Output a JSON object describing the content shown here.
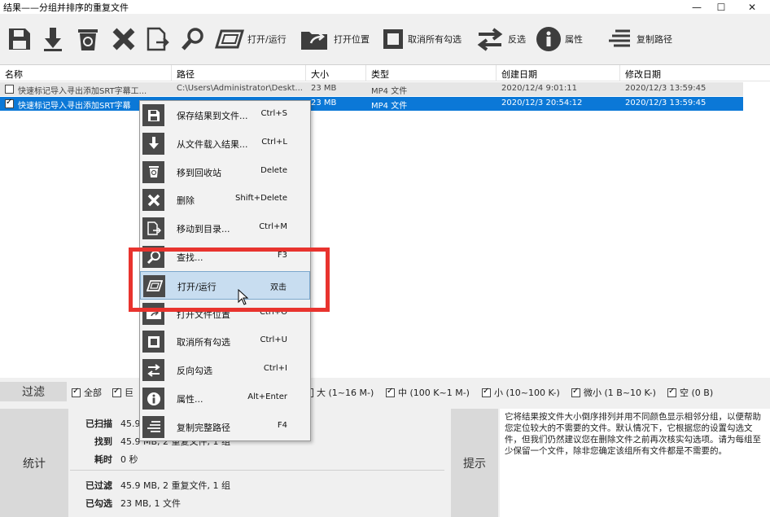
{
  "window": {
    "title": "结果——分组并排序的重复文件"
  },
  "toolbar": {
    "buttons": [
      {
        "icon": "save-icon",
        "label": ""
      },
      {
        "icon": "download-icon",
        "label": ""
      },
      {
        "icon": "recycle-bin-icon",
        "label": ""
      },
      {
        "icon": "delete-x-icon",
        "label": ""
      },
      {
        "icon": "move-file-icon",
        "label": ""
      },
      {
        "icon": "search-icon",
        "label": ""
      },
      {
        "icon": "open-run-icon",
        "label": "打开/运行"
      },
      {
        "icon": "open-location-icon",
        "label": "打开位置"
      },
      {
        "icon": "uncheck-all-icon",
        "label": "取消所有勾选"
      },
      {
        "icon": "invert-selection-icon",
        "label": "反选"
      },
      {
        "icon": "info-icon",
        "label": "属性"
      },
      {
        "icon": "copy-path-icon",
        "label": "复制路径"
      }
    ]
  },
  "list": {
    "columns": [
      "名称",
      "路径",
      "大小",
      "类型",
      "创建日期",
      "修改日期"
    ],
    "rows": [
      {
        "checked": false,
        "name": "快速标记导入寻出添加SRT字幕工...",
        "path": "C:\\Users\\Administrator\\Deskt...",
        "size": "23 MB",
        "type": "MP4 文件",
        "created": "2020/12/4 9:01:11",
        "modified": "2020/12/3 13:59:45"
      },
      {
        "checked": true,
        "name": "快速标记导入寻出添加SRT字幕",
        "path": "",
        "size": "23 MB",
        "type": "MP4 文件",
        "created": "2020/12/3 20:54:12",
        "modified": "2020/12/3 13:59:45"
      }
    ]
  },
  "filter": {
    "label": "过滤",
    "items": [
      "全部",
      "巨",
      "大 (1~16 M-)",
      "中 (100 K~1 M-)",
      "小 (10~100 K-)",
      "微小 (1 B~10 K-)",
      "空 (0 B)"
    ]
  },
  "stats": {
    "label": "统计",
    "lines": [
      {
        "k": "已扫描",
        "v": "45.9"
      },
      {
        "k": "找到",
        "v": "45.9 MB, 2 重复文件, 1 组"
      },
      {
        "k": "耗时",
        "v": "0 秒"
      },
      {
        "k": "已过滤",
        "v": "45.9 MB, 2 重复文件, 1 组"
      },
      {
        "k": "已勾选",
        "v": "23 MB, 1 文件"
      }
    ]
  },
  "tip": {
    "label": "提示",
    "text": "它将结果按文件大小倒序排列并用不同颜色显示相邻分组，以便帮助您定位较大的不需要的文件。默认情况下，它根据您的设置勾选文件，但我们仍然建议您在删除文件之前再次核实勾选项。请为每组至少保留一个文件，除非您确定该组所有文件都是不需要的。"
  },
  "context_menu": {
    "items": [
      {
        "icon": "save-icon",
        "label": "保存结果到文件...",
        "shortcut": "Ctrl+S"
      },
      {
        "icon": "download-icon",
        "label": "从文件载入结果...",
        "shortcut": "Ctrl+L"
      },
      {
        "icon": "recycle-bin-icon",
        "label": "移到回收站",
        "shortcut": "Delete"
      },
      {
        "icon": "delete-x-icon",
        "label": "删除",
        "shortcut": "Shift+Delete"
      },
      {
        "icon": "move-file-icon",
        "label": "移动到目录...",
        "shortcut": "Ctrl+M"
      },
      {
        "icon": "search-icon",
        "label": "查找...",
        "shortcut": "F3"
      },
      {
        "icon": "open-run-icon",
        "label": "打开/运行",
        "shortcut": "双击"
      },
      {
        "icon": "open-location-icon",
        "label": "打开文件位置",
        "shortcut": "Ctrl+O"
      },
      {
        "icon": "uncheck-all-icon",
        "label": "取消所有勾选",
        "shortcut": "Ctrl+U"
      },
      {
        "icon": "invert-selection-icon",
        "label": "反向勾选",
        "shortcut": "Ctrl+I"
      },
      {
        "icon": "info-icon",
        "label": "属性...",
        "shortcut": "Alt+Enter"
      },
      {
        "icon": "copy-path-icon",
        "label": "复制完整路径",
        "shortcut": "F4"
      }
    ],
    "highlighted_index": 6
  },
  "colors": {
    "selection": "#0b78d7",
    "menu_highlight": "#c8ddf0",
    "annotation": "#e8332e",
    "icon_bg": "#4a4a4a"
  }
}
